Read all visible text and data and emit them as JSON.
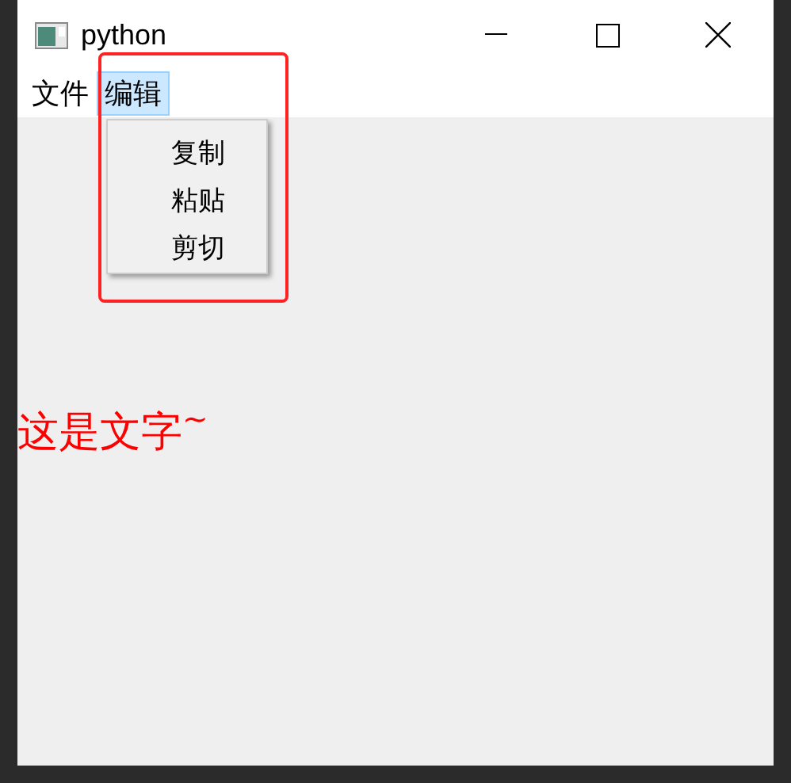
{
  "window": {
    "title": "python"
  },
  "menu_bar": [
    {
      "label": "文件",
      "selected": false
    },
    {
      "label": "编辑",
      "selected": true
    }
  ],
  "dropdown": {
    "items": [
      {
        "label": "复制"
      },
      {
        "label": "粘贴"
      },
      {
        "label": "剪切"
      }
    ]
  },
  "content": {
    "text": "这是文字$^{~}$"
  }
}
